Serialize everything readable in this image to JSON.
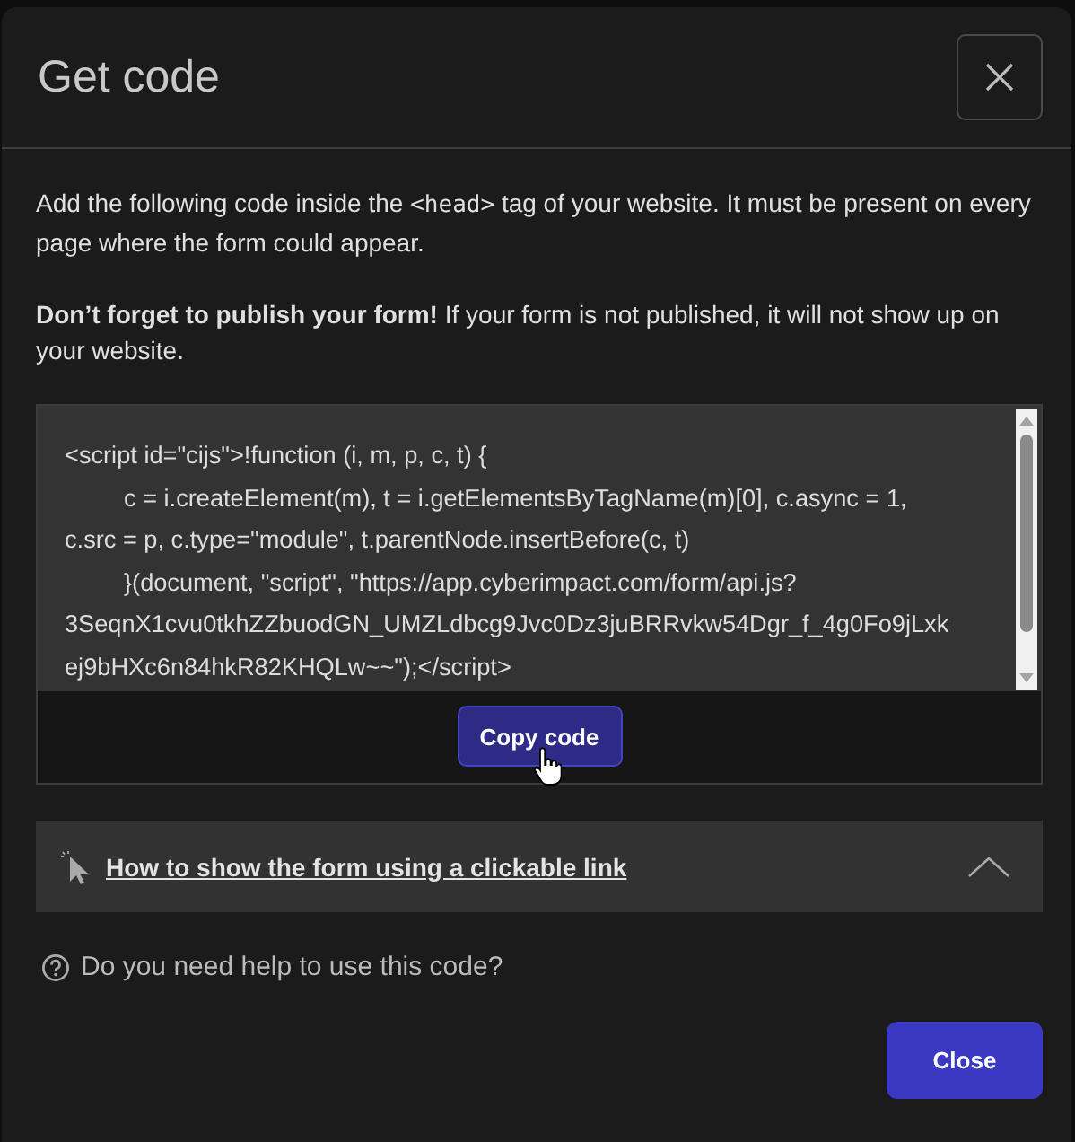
{
  "dialog": {
    "title": "Get code"
  },
  "intro": {
    "before": "Add the following code inside the",
    "code": "<head>",
    "after": "tag of your website. It must be present on every page where the form could appear."
  },
  "notice": {
    "bold": "Don’t forget to publish your form!",
    "text": "If your form is not published, it will not show up on your website."
  },
  "code_lines": [
    {
      "text": "<script id=\"cijs\">!function (i, m, p, c, t) {",
      "indented": false
    },
    {
      "text": "c = i.createElement(m), t = i.getElementsByTagName(m)[0], c.async = 1,",
      "indented": true
    },
    {
      "text": "c.src = p, c.type=\"module\", t.parentNode.insertBefore(c, t)",
      "indented": false
    },
    {
      "text": "}(document, \"script\", \"https://app.cyberimpact.com/form/api.js?",
      "indented": true
    },
    {
      "text": "3SeqnX1cvu0tkhZZbuodGN_UMZLdbcg9Jvc0Dz3juBRRvkw54Dgr_f_4g0Fo9jLxk",
      "indented": false
    },
    {
      "text": "ej9bHXc6n84hkR82KHQLw~~\");</script>",
      "indented": false
    }
  ],
  "copy_button": "Copy code",
  "expander": {
    "label": "How to show the form using a clickable link"
  },
  "help": "Do you need help to use this code?",
  "close_button": "Close"
}
